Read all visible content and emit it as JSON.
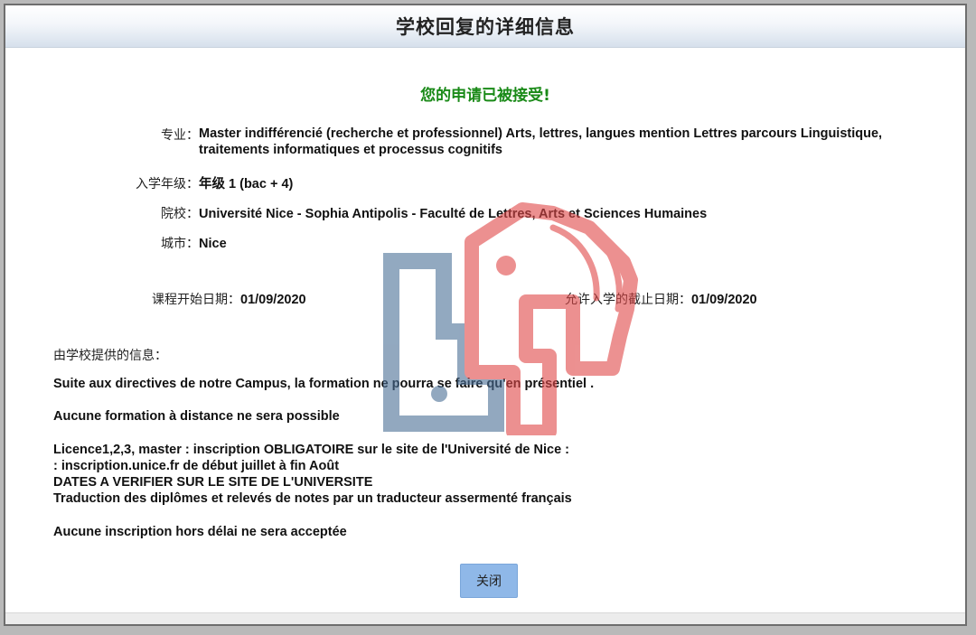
{
  "dialog": {
    "title": "学校回复的详细信息",
    "status": "您的申请已被接受!"
  },
  "details": {
    "major_label": "专业：",
    "major_value": "Master indifférencié (recherche et professionnel) Arts, lettres, langues mention Lettres parcours Linguistique, traitements informatiques et processus cognitifs",
    "level_label": "入学年级：",
    "level_value": "年级 1 (bac + 4)",
    "school_label": "院校：",
    "school_value": "Université Nice - Sophia Antipolis - Faculté de Lettres, Arts et Sciences Humaines",
    "city_label": "城市：",
    "city_value": "Nice",
    "start_label": "课程开始日期：",
    "start_value": "01/09/2020",
    "deadline_label": "允许入学的截止日期：",
    "deadline_value": "01/09/2020"
  },
  "school_info": {
    "label": "由学校提供的信息：",
    "messages": [
      "Suite aux directives de notre Campus, la formation ne pourra se faire qu'en présentiel .",
      "Aucune formation à distance ne sera possible",
      "Licence1,2,3, master : inscription OBLIGATOIRE sur le site de l'Université de Nice :\n: inscription.unice.fr de début juillet à fin Août\nDATES A VERIFIER SUR LE SITE DE L'UNIVERSITE\nTraduction des diplômes et relevés de notes par un traducteur assermenté français",
      "Aucune inscription hors délai ne sera acceptée"
    ]
  },
  "buttons": {
    "close_label": "关闭"
  },
  "colors": {
    "status_green": "#1a8a18",
    "button_blue": "#8fb8e8",
    "watermark_blue": "#4a6f96",
    "watermark_red": "#e04848"
  }
}
